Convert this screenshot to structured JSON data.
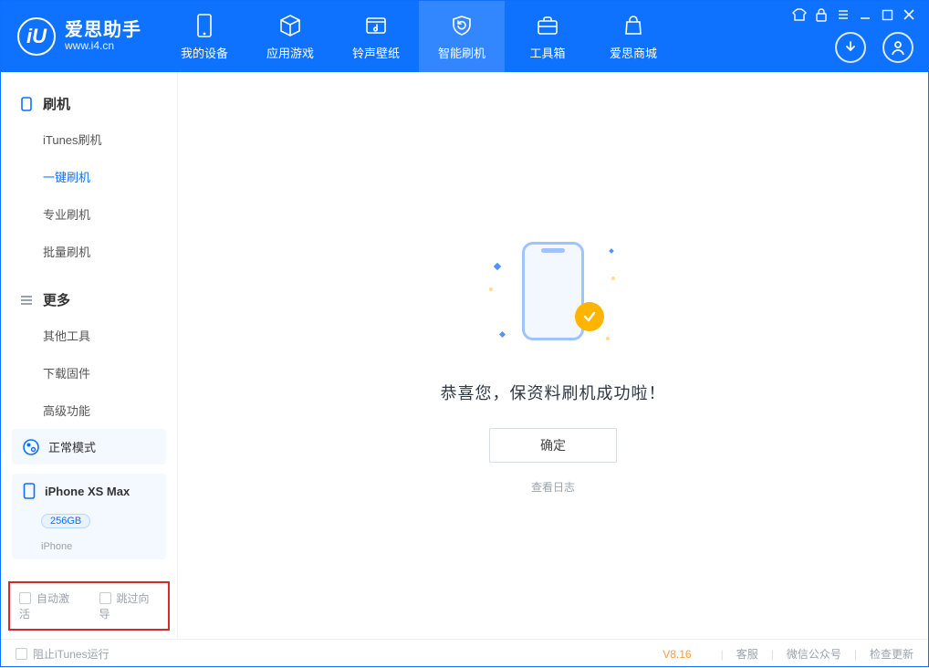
{
  "app": {
    "name": "爱思助手",
    "url": "www.i4.cn",
    "logo_letter": "iU"
  },
  "tabs": [
    {
      "id": "device",
      "label": "我的设备"
    },
    {
      "id": "apps",
      "label": "应用游戏"
    },
    {
      "id": "ring",
      "label": "铃声壁纸"
    },
    {
      "id": "flash",
      "label": "智能刷机",
      "active": true
    },
    {
      "id": "tools",
      "label": "工具箱"
    },
    {
      "id": "store",
      "label": "爱思商城"
    }
  ],
  "sidebar": {
    "group_flash": "刷机",
    "items_flash": [
      {
        "id": "itunes",
        "label": "iTunes刷机"
      },
      {
        "id": "onekey",
        "label": "一键刷机",
        "selected": true
      },
      {
        "id": "pro",
        "label": "专业刷机"
      },
      {
        "id": "batch",
        "label": "批量刷机"
      }
    ],
    "group_more": "更多",
    "items_more": [
      {
        "id": "other",
        "label": "其他工具"
      },
      {
        "id": "fw",
        "label": "下载固件"
      },
      {
        "id": "adv",
        "label": "高级功能"
      }
    ]
  },
  "device": {
    "mode": "正常模式",
    "name": "iPhone XS Max",
    "storage": "256GB",
    "type": "iPhone"
  },
  "options": {
    "auto_activate": "自动激活",
    "skip_guide": "跳过向导"
  },
  "main": {
    "success": "恭喜您，保资料刷机成功啦！",
    "ok": "确定",
    "view_log": "查看日志"
  },
  "footer": {
    "block_itunes": "阻止iTunes运行",
    "version": "V8.16",
    "support": "客服",
    "wechat": "微信公众号",
    "update": "检查更新"
  }
}
